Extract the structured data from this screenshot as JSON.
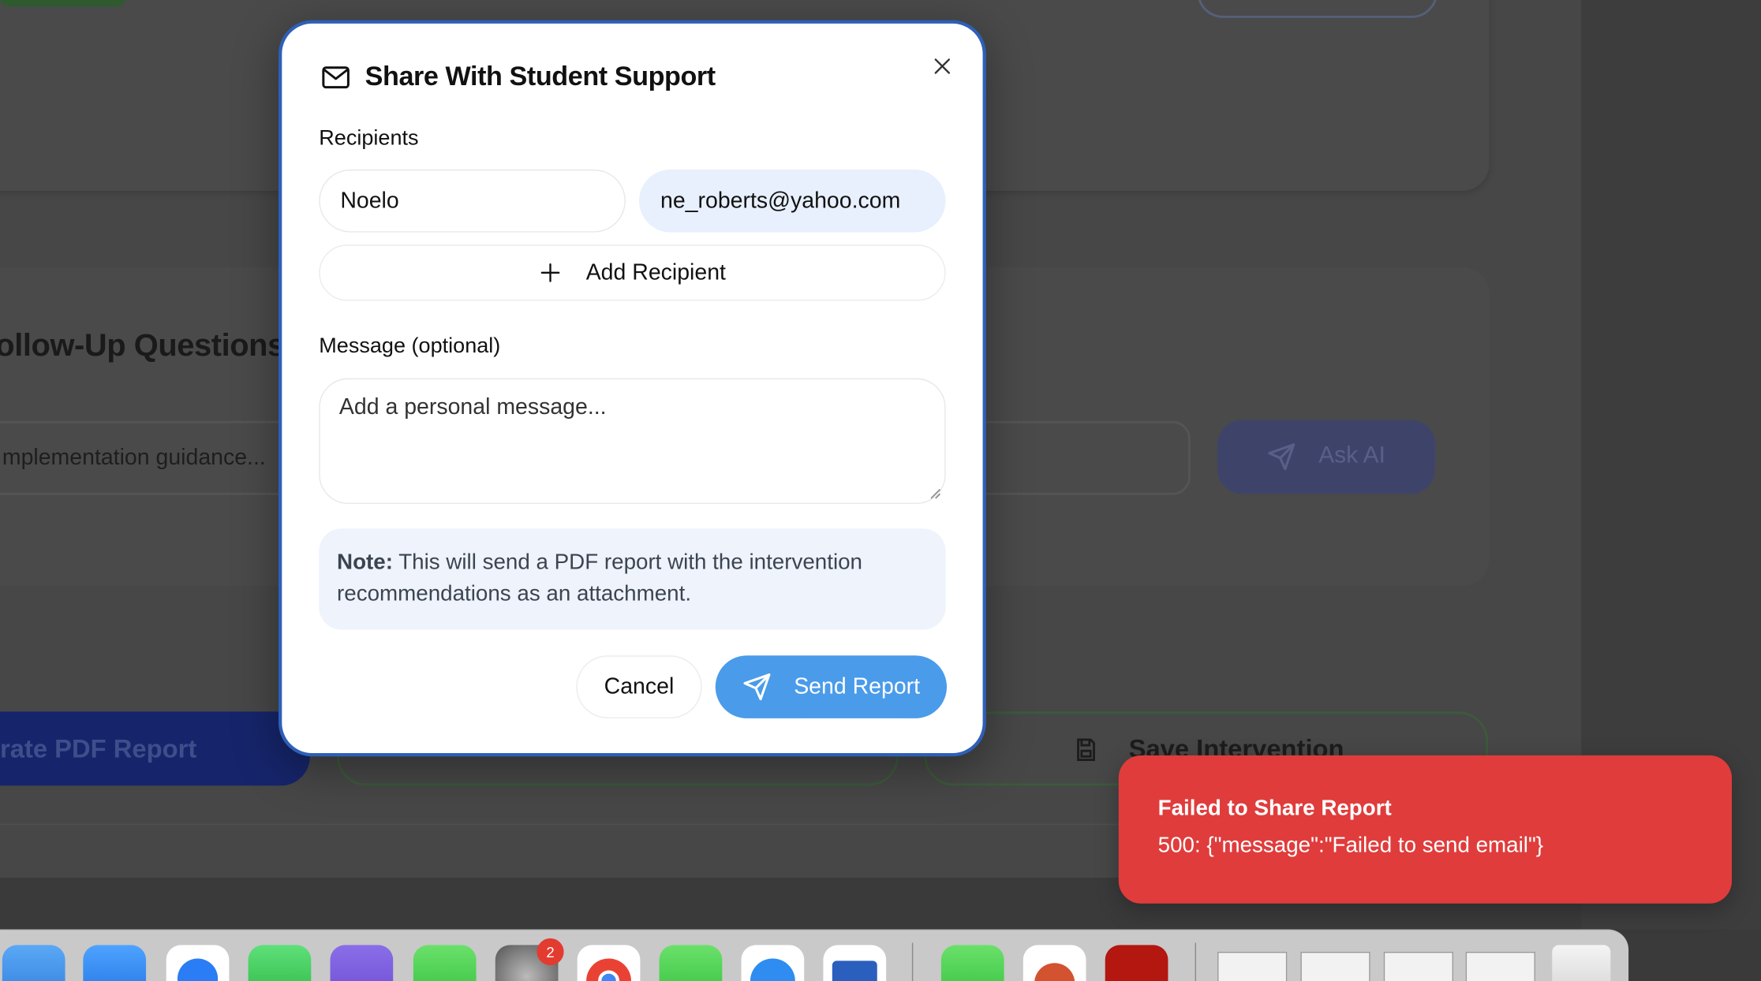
{
  "background": {
    "heading": "ollow-Up Questions",
    "input_placeholder": "mplementation guidance...",
    "ask_ai_label": "Ask AI",
    "generate_pdf_label": "rate PDF Report",
    "save_intervention_label": "Save Intervention"
  },
  "modal": {
    "title": "Share With Student Support",
    "recipients_label": "Recipients",
    "recipient_name": "Noelo",
    "recipient_email": "ne_roberts@yahoo.com",
    "add_recipient_label": "Add Recipient",
    "message_label": "Message (optional)",
    "message_placeholder": "Add a personal message...",
    "note_bold": "Note:",
    "note_text": " This will send a PDF report with the intervention recommendations as an attachment.",
    "cancel_label": "Cancel",
    "send_label": "Send Report"
  },
  "toast": {
    "title": "Failed to Share Report",
    "message": "500: {\"message\":\"Failed to send email\"}"
  },
  "dock": {
    "settings_badge": "2",
    "apps": [
      "mail-icon",
      "photos-icon",
      "messenger-icon",
      "whatsapp-icon",
      "viber-icon",
      "messages-icon",
      "system-settings-icon",
      "chrome-icon",
      "facetime-icon",
      "safari-icon",
      "word-icon",
      "wechat-icon",
      "powerpoint-icon",
      "acrobat-icon"
    ]
  },
  "colors": {
    "primary_blue": "#4a9bea",
    "modal_border": "#2e5fb8",
    "error_red": "#e03c3c",
    "note_bg": "#eef3fc"
  }
}
